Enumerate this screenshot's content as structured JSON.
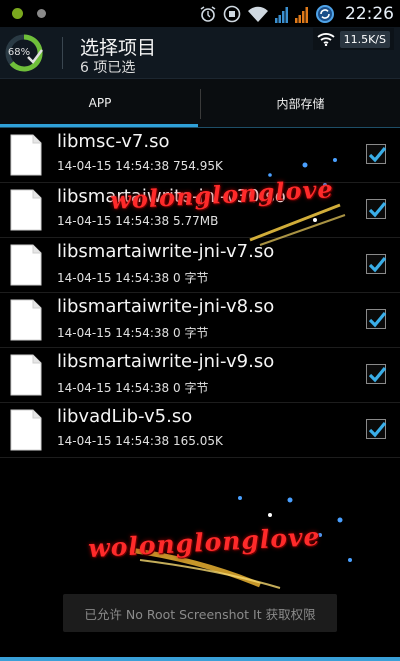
{
  "statusbar": {
    "time": "22:26",
    "icons": [
      "clover-icon",
      "notification-dot-icon",
      "alarm-icon",
      "sync-icon",
      "wifi-icon",
      "signal-icon",
      "signal-icon",
      "sync-ring-icon"
    ]
  },
  "header": {
    "battery_percent": "68%",
    "title": "选择项目",
    "subtitle": "6 项已选",
    "net_speed": "11.5K/S"
  },
  "tabs": [
    {
      "label": "APP",
      "selected": true
    },
    {
      "label": "内部存储",
      "selected": false
    }
  ],
  "files": [
    {
      "name": "libmsc-v7.so",
      "meta": "14-04-15 14:54:38  754.95K",
      "checked": true
    },
    {
      "name": "libsmartaiwrite-jni-v30.so",
      "meta": "14-04-15 14:54:38  5.77MB",
      "checked": true
    },
    {
      "name": "libsmartaiwrite-jni-v7.so",
      "meta": "14-04-15 14:54:38  0 字节",
      "checked": true
    },
    {
      "name": "libsmartaiwrite-jni-v8.so",
      "meta": "14-04-15 14:54:38  0 字节",
      "checked": true
    },
    {
      "name": "libsmartaiwrite-jni-v9.so",
      "meta": "14-04-15 14:54:38  0 字节",
      "checked": true
    },
    {
      "name": "libvadLib-v5.so",
      "meta": "14-04-15 14:54:38  165.05K",
      "checked": true
    }
  ],
  "watermark": {
    "text": "wolonglonglove"
  },
  "toast": {
    "text": "已允许 No Root Screenshot It 获取权限"
  },
  "colors": {
    "accent": "#2fa0d8",
    "check": "#3aaee8",
    "watermark": "#ff2a2a"
  }
}
